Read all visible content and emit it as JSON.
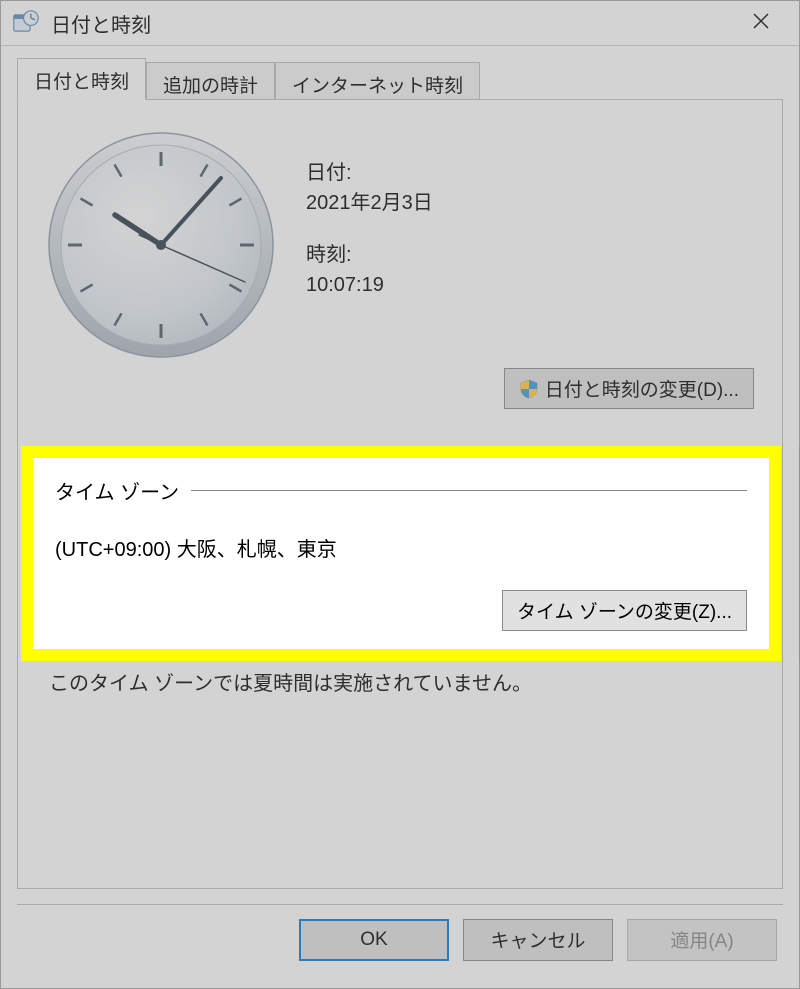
{
  "window": {
    "title": "日付と時刻"
  },
  "tabs": [
    {
      "label": "日付と時刻"
    },
    {
      "label": "追加の時計"
    },
    {
      "label": "インターネット時刻"
    }
  ],
  "datetime": {
    "date_label": "日付:",
    "date_value": "2021年2月3日",
    "time_label": "時刻:",
    "time_value": "10:07:19",
    "change_button": "日付と時刻の変更(D)..."
  },
  "timezone": {
    "group_title": "タイム ゾーン",
    "value": "(UTC+09:00) 大阪、札幌、東京",
    "change_button": "タイム ゾーンの変更(Z)...",
    "dst_note": "このタイム ゾーンでは夏時間は実施されていません。"
  },
  "buttons": {
    "ok": "OK",
    "cancel": "キャンセル",
    "apply": "適用(A)"
  }
}
